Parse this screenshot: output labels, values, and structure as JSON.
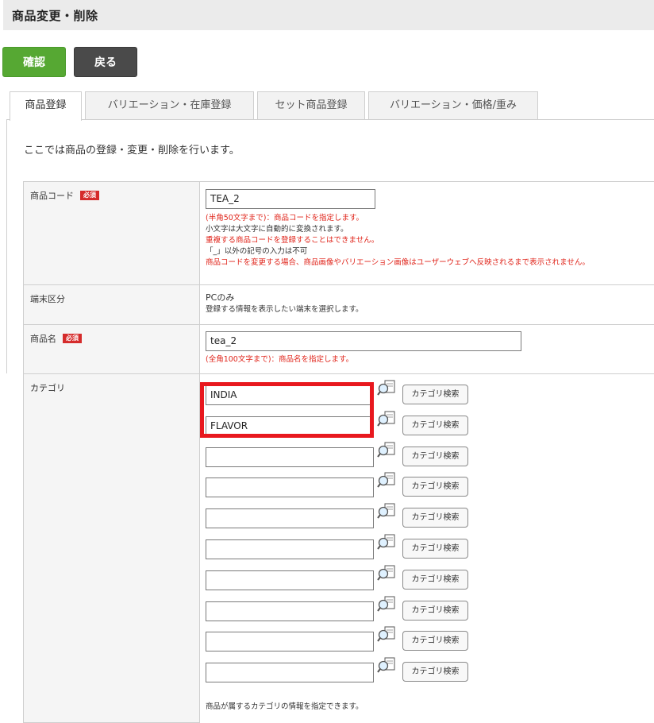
{
  "header": {
    "title": "商品変更・削除"
  },
  "actions": {
    "confirm_label": "確認",
    "back_label": "戻る"
  },
  "tabs": [
    {
      "label": "商品登録",
      "active": true
    },
    {
      "label": "バリエーション・在庫登録",
      "active": false
    },
    {
      "label": "セット商品登録",
      "active": false
    },
    {
      "label": "バリエーション・価格/重み",
      "active": false
    }
  ],
  "intro": "ここでは商品の登録・変更・削除を行います。",
  "required_badge": "必須",
  "product_code": {
    "label": "商品コード",
    "value": "TEA_2",
    "notes": [
      "(半角50文字まで)：商品コードを指定します。",
      "小文字は大文字に自動的に変換されます。",
      "重複する商品コードを登録することはできません。",
      "「_」以外の記号の入力は不可",
      "商品コードを変更する場合、商品画像やバリエーション画像はユーザーウェブへ反映されるまで表示されません。"
    ]
  },
  "device": {
    "label": "端末区分",
    "value": "PCのみ",
    "note": "登録する情報を表示したい端末を選択します。"
  },
  "product_name": {
    "label": "商品名",
    "value": "tea_2",
    "note": "(全角100文字まで)：商品名を指定します。"
  },
  "category": {
    "label": "カテゴリ",
    "search_label": "カテゴリ検索",
    "values": [
      "INDIA",
      "FLAVOR",
      "",
      "",
      "",
      "",
      "",
      "",
      "",
      ""
    ],
    "note": "商品が属するカテゴリの情報を指定できます。"
  },
  "colors": {
    "confirm": "#56a833",
    "back": "#4a4a4a",
    "required": "#d52b2b",
    "warning_text": "#e0251b",
    "highlight": "#e8181e"
  },
  "icons": {
    "category_search": "magnifier-icon"
  }
}
